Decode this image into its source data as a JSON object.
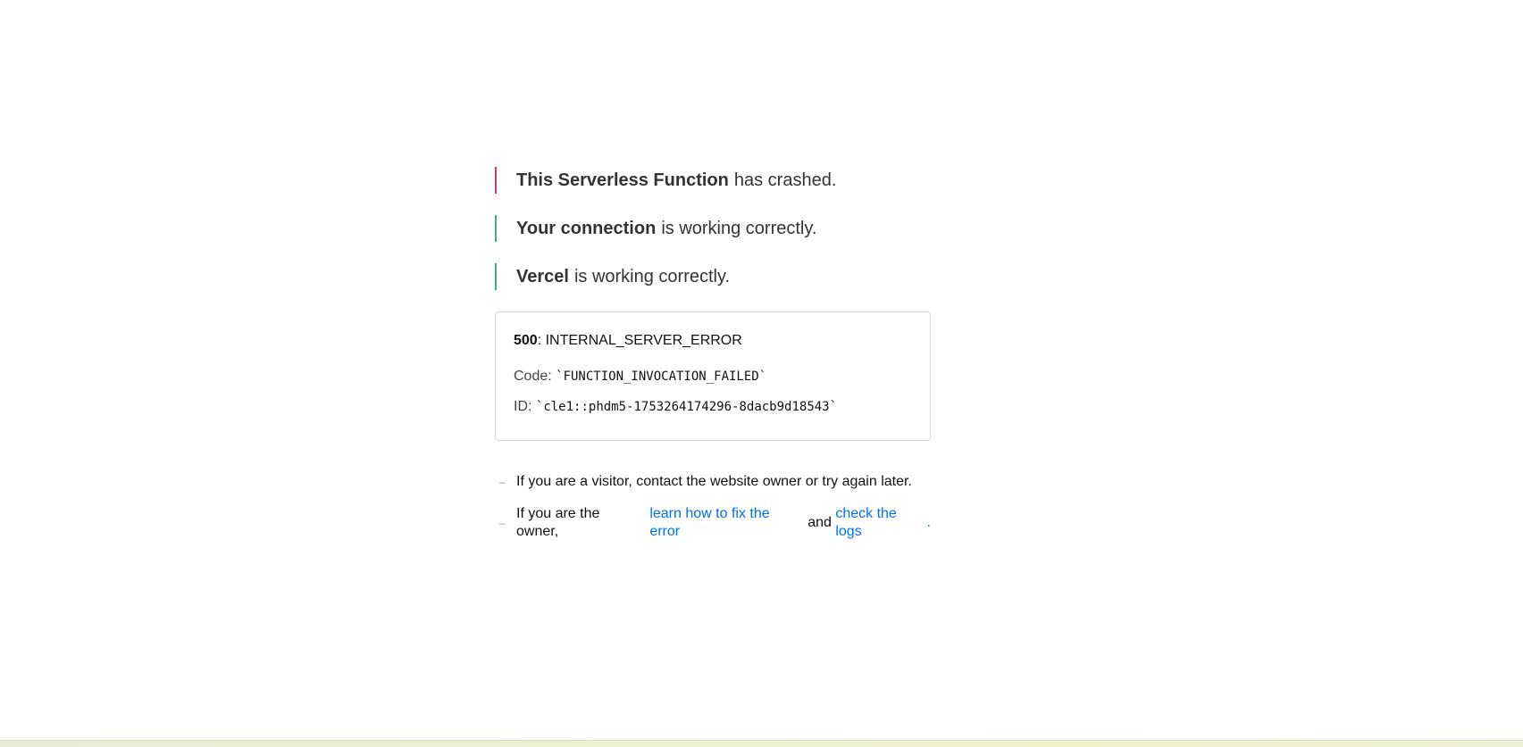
{
  "status": [
    {
      "type": "error",
      "bold": "This Serverless Function",
      "rest": "has crashed."
    },
    {
      "type": "ok",
      "bold": "Your connection",
      "rest": "is working correctly."
    },
    {
      "type": "ok",
      "bold": "Vercel",
      "rest": "is working correctly."
    }
  ],
  "error_box": {
    "code_number": "500",
    "code_name": ": INTERNAL_SERVER_ERROR",
    "code_label": "Code: ",
    "code_value": "`FUNCTION_INVOCATION_FAILED`",
    "id_label": "ID: ",
    "id_value": "`cle1::phdm5-1753264174296-8dacb9d18543`"
  },
  "help": {
    "dash": "–",
    "visitor_text": "If you are a visitor, contact the website owner or try again later.",
    "owner_prefix": "If you are the owner,",
    "fix_link": "learn how to fix the error",
    "and_text": "and",
    "logs_link": "check the logs",
    "period": "."
  },
  "colors": {
    "error_bar": "#d23a69",
    "ok_bar": "#4aa67f",
    "link": "#0070f3"
  }
}
